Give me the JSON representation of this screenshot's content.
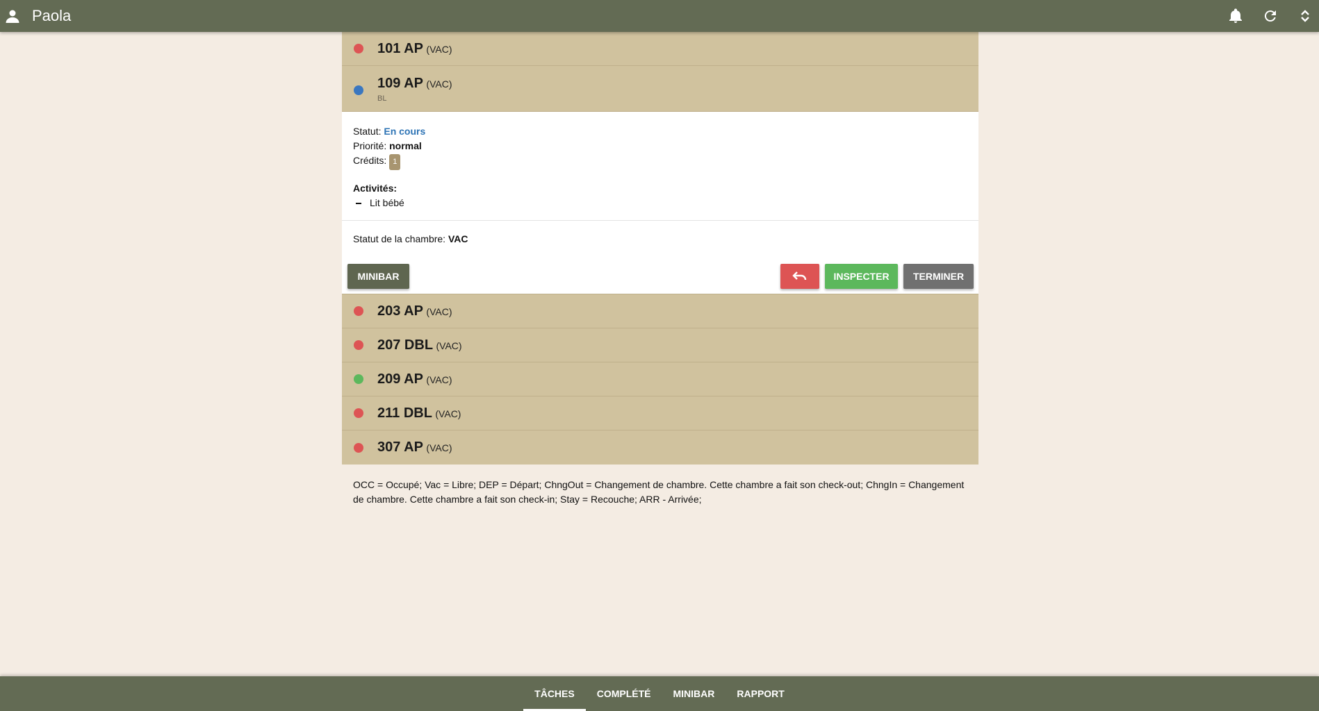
{
  "header": {
    "user_name": "Paola"
  },
  "rooms_before": [
    {
      "number": "101 AP",
      "status": "(VAC)",
      "dot_color": "#dd5454"
    }
  ],
  "expanded_room": {
    "number": "109 AP",
    "status": "(VAC)",
    "sub": "BL",
    "dot_color": "#3a77c0",
    "statut_label": "Statut:",
    "statut_value": "En cours",
    "priorite_label": "Priorité:",
    "priorite_value": "normal",
    "credits_label": "Crédits:",
    "credits_value": "1",
    "activites_label": "Activités:",
    "activites": [
      "Lit bébé"
    ],
    "room_status_label": "Statut de la chambre:",
    "room_status_value": "VAC",
    "buttons": {
      "minibar": "MINIBAR",
      "inspecter": "INSPECTER",
      "terminer": "TERMINER"
    }
  },
  "rooms_after": [
    {
      "number": "203 AP",
      "status": "(VAC)",
      "dot_color": "#dd5454"
    },
    {
      "number": "207 DBL",
      "status": "(VAC)",
      "dot_color": "#dd5454"
    },
    {
      "number": "209 AP",
      "status": "(VAC)",
      "dot_color": "#5cb85c"
    },
    {
      "number": "211 DBL",
      "status": "(VAC)",
      "dot_color": "#dd5454"
    },
    {
      "number": "307 AP",
      "status": "(VAC)",
      "dot_color": "#dd5454"
    }
  ],
  "legend": "OCC = Occupé; Vac = Libre; DEP = Départ; ChngOut = Changement de chambre. Cette chambre a fait son check-out; ChngIn = Changement de chambre. Cette chambre a fait son check-in; Stay = Recouche; ARR - Arrivée;",
  "bottom_tabs": [
    {
      "label": "TÂCHES",
      "active": true
    },
    {
      "label": "COMPLÉTÉ",
      "active": false
    },
    {
      "label": "MINIBAR",
      "active": false
    },
    {
      "label": "RAPPORT",
      "active": false
    }
  ],
  "colors": {
    "header_bg": "#636b54",
    "row_bg": "#d0c29e",
    "page_bg": "#f4ece3"
  }
}
